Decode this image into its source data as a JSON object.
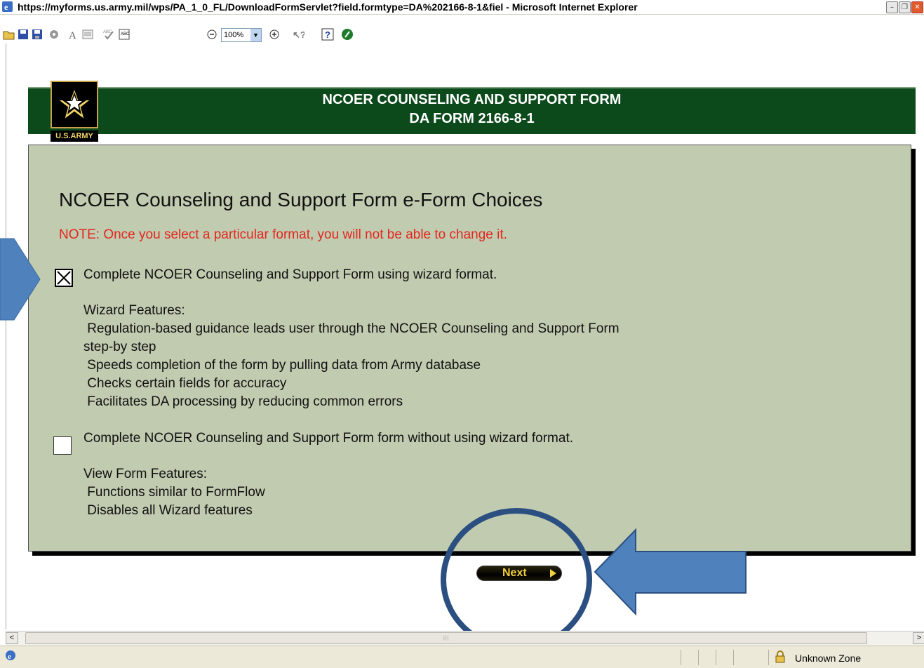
{
  "window": {
    "title": "https://myforms.us.army.mil/wps/PA_1_0_FL/DownloadFormServlet?field.formtype=DA%202166-8-1&fiel - Microsoft Internet Explorer",
    "controls": {
      "minimize": "–",
      "restore": "❐",
      "close": "✕"
    }
  },
  "toolbar": {
    "zoom_value": "100%",
    "icons": [
      "open-icon",
      "save-icon",
      "save-as-icon",
      "properties-icon",
      "text-icon",
      "form-icon",
      "spellcheck-icon",
      "preview-icon",
      "zoom-out-icon",
      "zoom-dropdown",
      "zoom-in-icon",
      "whats-this-icon",
      "help-icon",
      "go-icon"
    ]
  },
  "header": {
    "line1": "NCOER COUNSELING AND SUPPORT FORM",
    "line2": "DA FORM 2166-8-1",
    "logo_caption": "U.S.ARMY"
  },
  "panel": {
    "heading": "NCOER Counseling and Support Form e-Form Choices",
    "note": "NOTE:  Once you select a particular format, you will not be able to change it.",
    "option1": {
      "label": "Complete NCOER Counseling and Support Form using wizard format.",
      "checked": true,
      "features_title": "Wizard Features:",
      "features": [
        " Regulation-based guidance leads user through the NCOER Counseling and Support Form",
        "step-by step",
        " Speeds completion of the form by pulling data from Army database",
        " Checks certain fields for accuracy",
        " Facilitates DA processing by reducing common errors"
      ]
    },
    "option2": {
      "label": "Complete NCOER Counseling and Support Form form without using wizard format.",
      "checked": false,
      "features_title": "View Form Features:",
      "features": [
        " Functions similar to FormFlow",
        " Disables all Wizard features"
      ]
    }
  },
  "next_button": {
    "label": "Next"
  },
  "statusbar": {
    "zone": "Unknown Zone"
  },
  "colors": {
    "header_bg": "#0c4a1c",
    "panel_bg": "#c1cbb0",
    "note_color": "#e1271f",
    "annotation_blue": "#4f81bd",
    "annotation_circle": "#2a4f80"
  }
}
